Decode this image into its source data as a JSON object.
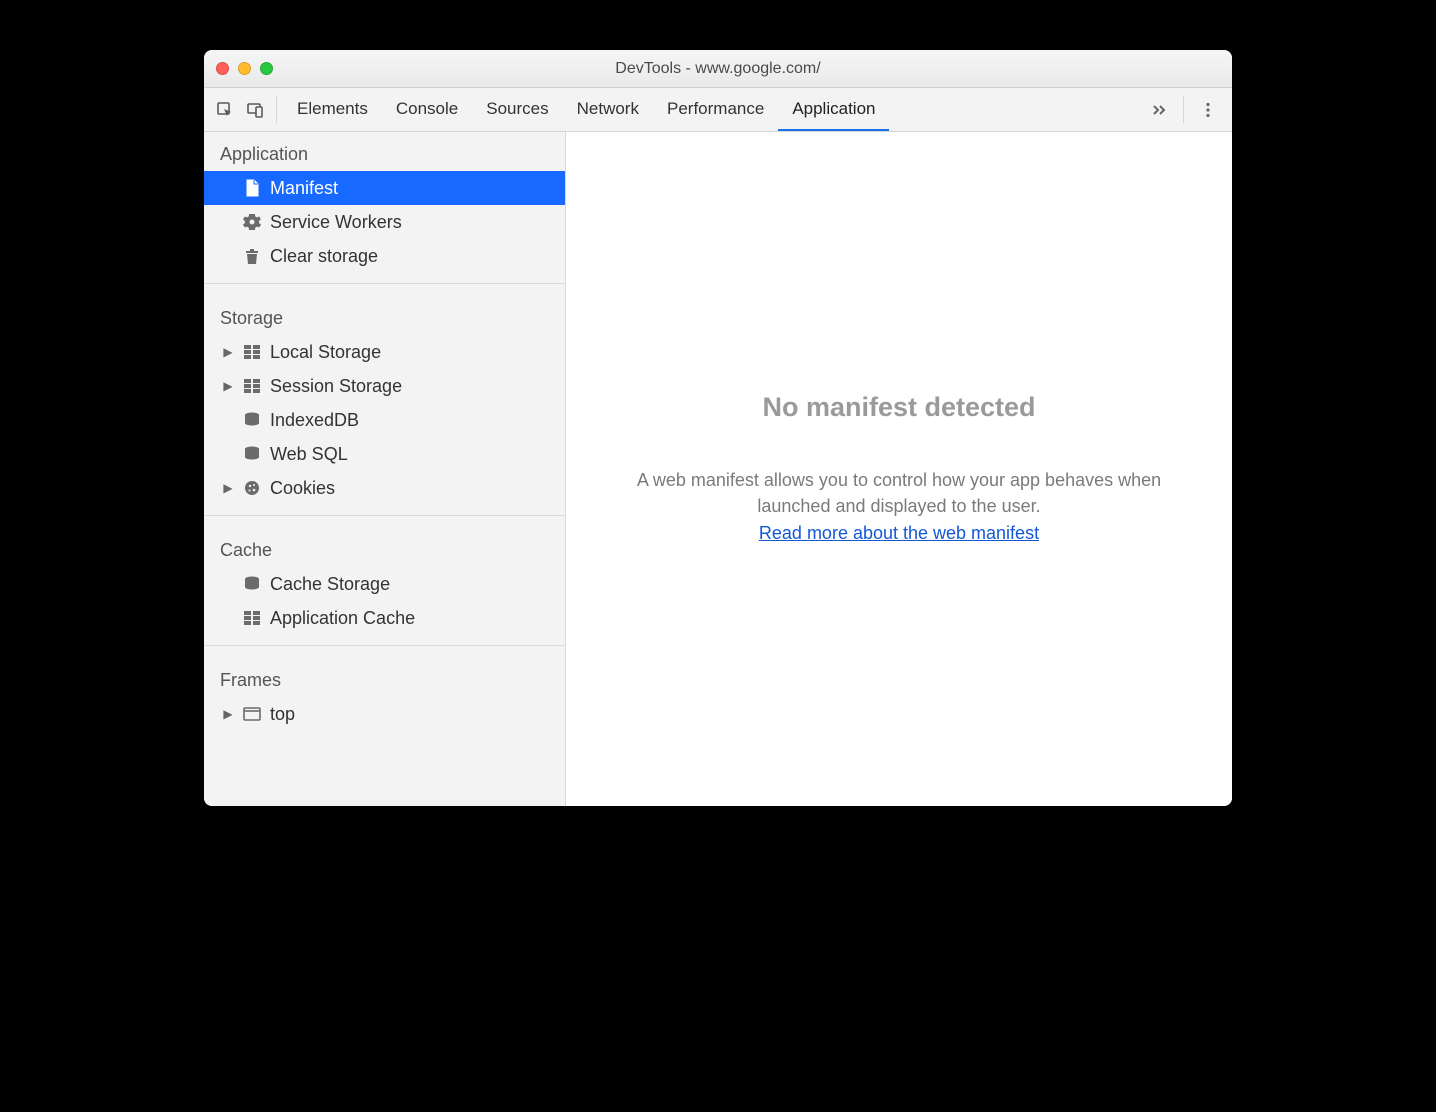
{
  "window": {
    "title": "DevTools - www.google.com/"
  },
  "toolbar": {
    "inspect_label": "Select element",
    "device_label": "Toggle device toolbar",
    "tabs": [
      {
        "label": "Elements"
      },
      {
        "label": "Console"
      },
      {
        "label": "Sources"
      },
      {
        "label": "Network"
      },
      {
        "label": "Performance"
      },
      {
        "label": "Application",
        "active": true
      }
    ],
    "overflow": "More tabs",
    "menu": "Customize DevTools"
  },
  "sidebar": {
    "sections": {
      "application": {
        "title": "Application",
        "items": [
          {
            "label": "Manifest",
            "selected": true
          },
          {
            "label": "Service Workers"
          },
          {
            "label": "Clear storage"
          }
        ]
      },
      "storage": {
        "title": "Storage",
        "items": [
          {
            "label": "Local Storage",
            "expandable": true
          },
          {
            "label": "Session Storage",
            "expandable": true
          },
          {
            "label": "IndexedDB"
          },
          {
            "label": "Web SQL"
          },
          {
            "label": "Cookies",
            "expandable": true
          }
        ]
      },
      "cache": {
        "title": "Cache",
        "items": [
          {
            "label": "Cache Storage"
          },
          {
            "label": "Application Cache"
          }
        ]
      },
      "frames": {
        "title": "Frames",
        "items": [
          {
            "label": "top",
            "expandable": true
          }
        ]
      }
    }
  },
  "main": {
    "heading": "No manifest detected",
    "body": "A web manifest allows you to control how your app behaves when launched and displayed to the user.",
    "link_label": "Read more about the web manifest"
  }
}
